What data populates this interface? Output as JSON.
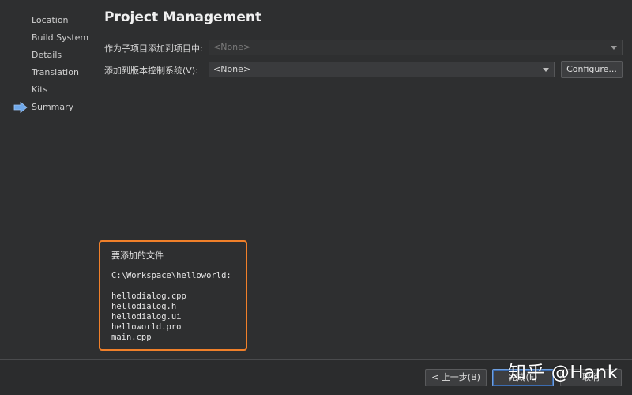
{
  "sidebar": {
    "steps": [
      {
        "label": "Location"
      },
      {
        "label": "Build System"
      },
      {
        "label": "Details"
      },
      {
        "label": "Translation"
      },
      {
        "label": "Kits"
      },
      {
        "label": "Summary",
        "current": true
      }
    ],
    "current_indicator_icon": "right-arrow-icon",
    "indicator_color": "#6fa8ea"
  },
  "main": {
    "title": "Project Management",
    "subproject": {
      "label": "作为子项目添加到项目中:",
      "value": "<None>",
      "enabled": false
    },
    "vcs": {
      "label": "添加到版本控制系统(V):",
      "value": "<None>",
      "configure_label": "Configure..."
    },
    "files": {
      "heading": "要添加的文件",
      "path": "C:\\Workspace\\helloworld:",
      "list": [
        "hellodialog.cpp",
        "hellodialog.h",
        "hellodialog.ui",
        "helloworld.pro",
        "main.cpp"
      ],
      "highlight_color": "#f0802a"
    }
  },
  "footer": {
    "back_label": "< 上一步(B)",
    "finish_label": "完成(F)",
    "cancel_label": "取消"
  },
  "watermark": "知乎 @Hank"
}
